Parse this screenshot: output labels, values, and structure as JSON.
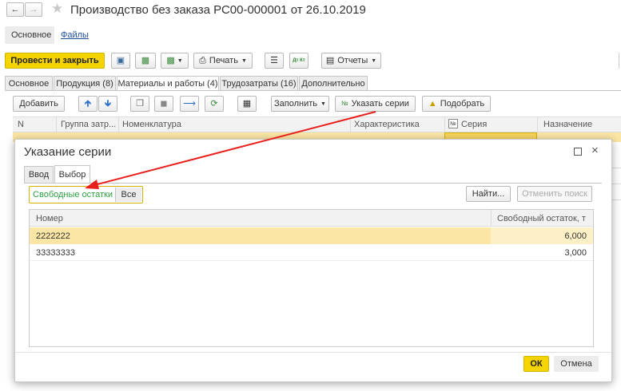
{
  "window": {
    "title": "Производство без заказа РС00-000001 от 26.10.2019",
    "nav_links": [
      "Основное",
      "Файлы"
    ]
  },
  "toolbar": {
    "post_close_label": "Провести и закрыть",
    "print_label": "Печать",
    "dt_kt_label": "Дт Кт",
    "reports_label": "Отчеты"
  },
  "doc_tabs": [
    "Основное",
    "Продукция (8)",
    "Материалы и работы (4)",
    "Трудозатраты (16)",
    "Дополнительно"
  ],
  "table_toolbar": {
    "add_label": "Добавить",
    "fill_label": "Заполнить",
    "specify_series_label": "Указать серии",
    "pick_label": "Подобрать"
  },
  "table": {
    "columns": [
      "N",
      "Группа затр...",
      "Номенклатура",
      "Характеристика",
      "Серия",
      "Назначение"
    ],
    "series_icon": "№"
  },
  "dialog": {
    "title": "Указание серии",
    "tabs": [
      "Ввод",
      "Выбор"
    ],
    "filter_options": [
      "Свободные остатки",
      "Все"
    ],
    "find_label": "Найти...",
    "cancel_search_label": "Отменить поиск",
    "columns": [
      "Номер",
      "Свободный остаток, т"
    ],
    "rows": [
      {
        "number": "2222222",
        "balance": "6,000"
      },
      {
        "number": "33333333",
        "balance": "3,000"
      }
    ],
    "ok_label": "ОК",
    "cancel_label": "Отмена"
  },
  "colors": {
    "accent_yellow": "#f6d400",
    "selected_row": "#fbe6a5",
    "annotation_arrow": "#e8201c",
    "active_filter_text": "#2f9e41"
  }
}
